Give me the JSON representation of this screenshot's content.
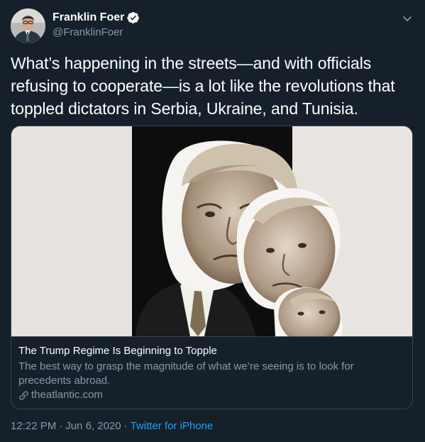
{
  "author": {
    "display_name": "Franklin Foer",
    "handle": "@FranklinFoer",
    "verified_icon": "verified-badge-icon"
  },
  "tweet": {
    "text": "What’s happening in the streets—and with officials refusing to cooperate—is a lot like the revolutions that toppled dictators in Serbia, Ukraine, and Tunisia."
  },
  "card": {
    "title": "The Trump Regime Is Beginning to Topple",
    "description": "The best way to grasp the magnitude of what we’re seeing is to look for precedents abroad.",
    "domain": "theatlantic.com"
  },
  "meta": {
    "time": "12:22 PM",
    "date": "Jun 6, 2020",
    "separator": "·",
    "source": "Twitter for iPhone"
  },
  "colors": {
    "background": "#15202b",
    "accent": "#1da1f2",
    "secondary_text": "#8899a6",
    "border": "#38444d"
  }
}
